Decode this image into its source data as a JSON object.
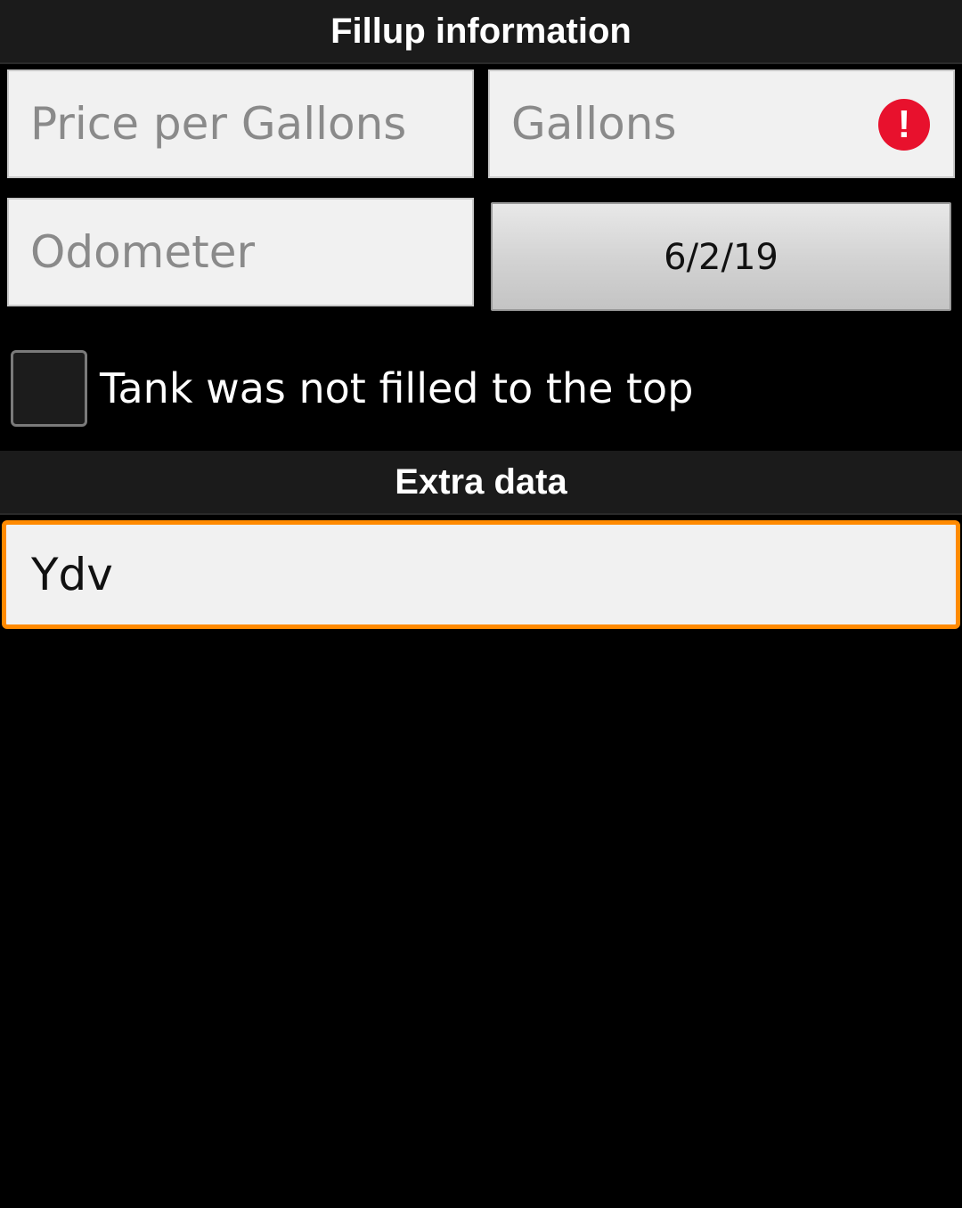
{
  "sections": {
    "fillup_title": "Fillup information",
    "extra_title": "Extra data"
  },
  "fields": {
    "price_per_gallons": {
      "placeholder": "Price per Gallons",
      "value": ""
    },
    "gallons": {
      "placeholder": "Gallons",
      "value": "",
      "error": true
    },
    "odometer": {
      "placeholder": "Odometer",
      "value": ""
    }
  },
  "date_button": {
    "label": "6/2/19"
  },
  "checkbox": {
    "label": "Tank was not filled to the top",
    "checked": false
  },
  "extra_data": {
    "value": "Ydv"
  },
  "icons": {
    "error": "error-icon"
  },
  "colors": {
    "background": "#000000",
    "header": "#1b1b1b",
    "focus_border": "#ff8a00",
    "error": "#e8112d"
  }
}
